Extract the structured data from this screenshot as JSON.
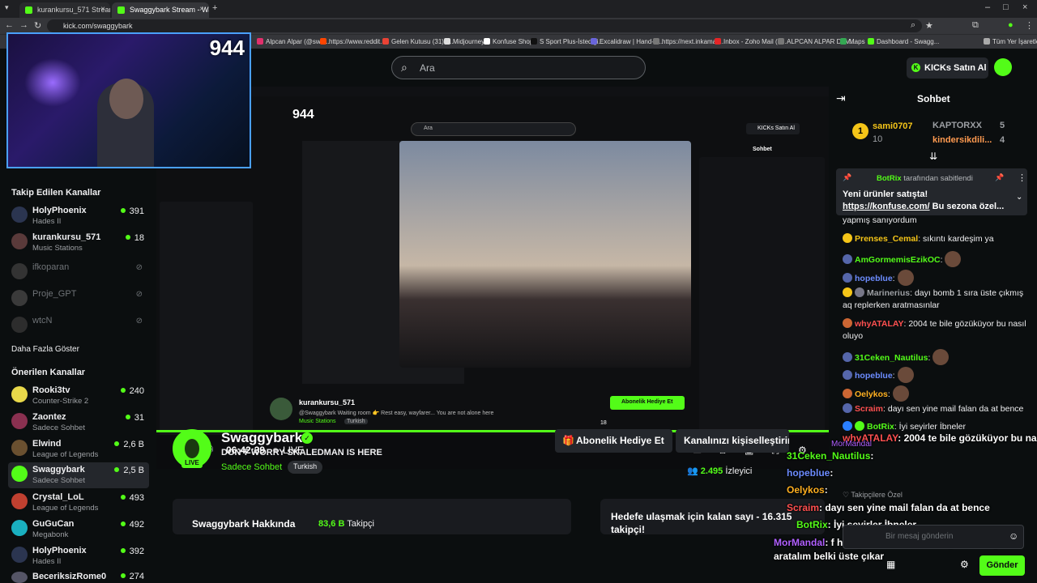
{
  "browser": {
    "tabs": [
      {
        "title": "kurankursu_571 Stream - Vi"
      },
      {
        "title": "Swaggybark Stream - Watch Li"
      }
    ],
    "url": "kick.com/swaggybark",
    "bookmarks": [
      "Alpcan Alpar (@swa...",
      "https://www.reddit...",
      "Gelen Kutusu (31) -...",
      "Midjourney",
      "Konfuse Shop",
      "S Sport Plus-İstediği...",
      "Excalidraw | Hand-d...",
      "https://next.inkamat...",
      "Inbox - Zoho Mail (a...",
      "ALPCAN ALPAR DEV...",
      "Maps",
      "Dashboard - Swagg..."
    ],
    "all_bookmarks": "Tüm Yer İşaretleri"
  },
  "header": {
    "search_placeholder": "Ara",
    "kicks_button": "KICKs Satın Al"
  },
  "webcam": {
    "count": "944"
  },
  "sidebar": {
    "followed_title": "Takip Edilen Kanallar",
    "followed": [
      {
        "name": "HolyPhoenix",
        "category": "Hades II",
        "viewers": "391",
        "online": true
      },
      {
        "name": "kurankursu_571",
        "category": "Music Stations",
        "viewers": "18",
        "online": true
      },
      {
        "name": "ifkoparan",
        "online": false
      },
      {
        "name": "Proje_GPT",
        "online": false
      },
      {
        "name": "wtcN",
        "online": false
      }
    ],
    "show_more": "Daha Fazla Göster",
    "recommended_title": "Önerilen Kanallar",
    "recommended": [
      {
        "name": "Rooki3tv",
        "category": "Counter-Strike 2",
        "viewers": "240"
      },
      {
        "name": "Zaontez",
        "category": "Sadece Sohbet",
        "viewers": "31"
      },
      {
        "name": "Elwind",
        "category": "League of Legends",
        "viewers": "2,6 B"
      },
      {
        "name": "Swaggybark",
        "category": "Sadece Sohbet",
        "viewers": "2,5 B"
      },
      {
        "name": "Crystal_LoL",
        "category": "League of Legends",
        "viewers": "493"
      },
      {
        "name": "GuGuCan",
        "category": "Megabonk",
        "viewers": "492"
      },
      {
        "name": "HolyPhoenix",
        "category": "Hades II",
        "viewers": "392"
      },
      {
        "name": "BeceriksizRome0",
        "category": "",
        "viewers": "274"
      }
    ]
  },
  "player": {
    "time": "06:42:39",
    "live": "LIVE",
    "nested": {
      "count": "944",
      "streamer": "kurankursu_571",
      "category": "Music Stations",
      "tag": "Turkish",
      "message": "@Swaggybark Waiting room 👉 Rest easy, wayfarer... You are not alone here",
      "gift": "Abonelik Hediye Et",
      "viewers": "18",
      "search": "Ara",
      "kicks": "KICKs Satın Al",
      "chat": "Sohbet"
    }
  },
  "channel": {
    "name": "Swaggybark",
    "title": "DON'T WORRY SKALEDMAN IS HERE",
    "category": "Sadece Sohbet",
    "tag": "Turkish",
    "live_badge": "LIVE",
    "gift_button": "Abonelik Hediye Et",
    "customize_button": "Kanalınızı kişiselleştirin",
    "viewers": "2.495",
    "viewers_label": "İzleyici",
    "about_title": "Swaggybark Hakkında",
    "followers": "83,6 B",
    "followers_label": "Takipçi",
    "goal_text": "Hedefe ulaşmak için kalan sayı - 16.315 takipçi!"
  },
  "chat": {
    "title": "Sohbet",
    "leaderboard": [
      {
        "rank": "1",
        "name": "sami0707",
        "value": "10"
      },
      {
        "name": "KAPTORXX",
        "value": "5"
      },
      {
        "name": "kindersikdili...",
        "value": "4"
      }
    ],
    "pinned": {
      "by": "BotRix",
      "by_suffix": "tarafından sabitlendi",
      "text": "Yeni ürünler satışta!",
      "link": "https://konfuse.com/",
      "rest": "Bu sezona özel..."
    },
    "messages": [
      {
        "user": "",
        "text": "yapmış sanıyordum"
      },
      {
        "user": "Prenses_Cemal",
        "text": ": sıkıntı kardeşim ya",
        "color": "#f5c518"
      },
      {
        "user": "AmGormemisEzikOC",
        "text": ":",
        "color": "#53fc18"
      },
      {
        "user": "hopeblue",
        "text": ":",
        "color": "#6c8cff"
      },
      {
        "user": "Marinerius",
        "text": ": dayı bomb 1 sıra üste çıkmış aq replerken aratmasınlar",
        "color": "#9c9fa3"
      },
      {
        "user": "whyATALAY",
        "text": ": 2004 te bile gözüküyor bu nasıl oluyo",
        "color": "#ff5050"
      },
      {
        "user": "31Ceken_Nautilus",
        "text": ":",
        "color": "#53fc18"
      },
      {
        "user": "hopeblue",
        "text": ":",
        "color": "#6c8cff"
      },
      {
        "user": "Oelykos",
        "text": ":",
        "color": "#ffb020"
      },
      {
        "user": "Scraim",
        "text": ": dayı sen yine mail falan da at bence",
        "color": "#ff5050"
      },
      {
        "user": "BotRix",
        "text": ": İyi seyirler İbneler",
        "color": "#53fc18"
      }
    ],
    "overlay": [
      {
        "user": "whyATALAY",
        "text": ": 2004 te bile gözüküyor bu nasıl oluyo"
      },
      {
        "user": "MorMandal",
        "text": ": f h b için kelime belirle dayı sıkıldıkça aratalım belki üste çıkar"
      },
      {
        "user": "31Ceken_Nautilus",
        "text": ":"
      },
      {
        "user": "hopeblue",
        "text": ":"
      },
      {
        "user": "Oelykos",
        "text": ":"
      },
      {
        "user": "Scraim",
        "text": ": dayı sen yine mail falan da at bence"
      },
      {
        "user": "BotRix",
        "text": ": İyi seyirler İbneler"
      }
    ],
    "subscribers_label": "Takipçilere Özel",
    "input_placeholder": "Bir mesaj gönderin",
    "send_button": "Gönder"
  },
  "colors": {
    "accent": "#53fc18",
    "background": "#0b0e0f",
    "panel": "#24272c"
  }
}
